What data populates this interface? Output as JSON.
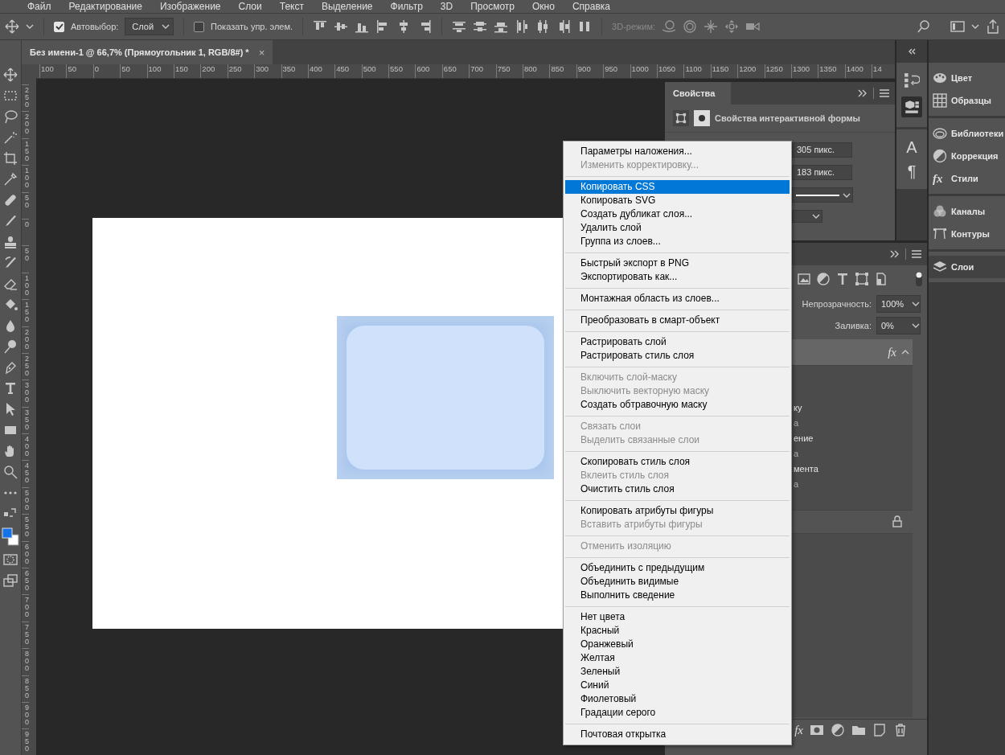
{
  "menu_bar": [
    "Файл",
    "Редактирование",
    "Изображение",
    "Слои",
    "Текст",
    "Выделение",
    "Фильтр",
    "3D",
    "Просмотр",
    "Окно",
    "Справка"
  ],
  "options_bar": {
    "auto_select": {
      "label": "Автовыбор:",
      "checked": true
    },
    "auto_select_target": "Слой",
    "show_controls": {
      "label": "Показать упр. элем.",
      "checked": false
    },
    "mode_3d_label": "3D-режим:"
  },
  "document_tab": {
    "title": "Без имени-1 @ 66,7% (Прямоугольник 1, RGB/8#) *",
    "close": "×"
  },
  "top_ruler": [
    "100",
    "50",
    "0",
    "50",
    "100",
    "150",
    "200",
    "250",
    "300",
    "350",
    "400",
    "450",
    "500",
    "550",
    "600",
    "650",
    "700",
    "750",
    "800",
    "850",
    "900",
    "950",
    "1000",
    "1050",
    "1100",
    "1150",
    "1200",
    "1250",
    "1300",
    "1350",
    "1400",
    "14"
  ],
  "left_ruler": [
    "250",
    "200",
    "150",
    "100",
    "50",
    "0",
    "50",
    "100",
    "150",
    "200",
    "250",
    "300",
    "350",
    "400",
    "450",
    "500",
    "550",
    "600",
    "650",
    "700",
    "750",
    "800",
    "850",
    "900",
    "950"
  ],
  "properties_panel": {
    "tab": "Свойства",
    "heading": "Свойства интерактивной формы",
    "width": "305 пикс.",
    "height": "183 пикс."
  },
  "layers_panel": {
    "opacity_label": "Непрозрачность:",
    "opacity": "100%",
    "fill_label": "Заливка:",
    "fill": "0%",
    "layer_row": {
      "selected": true,
      "badge": "fx"
    },
    "effects": [
      {
        "text": "ку",
        "muted": false
      },
      {
        "text": "а",
        "muted": true
      },
      {
        "text": "ение",
        "muted": false
      },
      {
        "text": "а",
        "muted": true
      },
      {
        "text": "мента",
        "muted": false
      },
      {
        "text": "а",
        "muted": true
      }
    ],
    "bottom_fx": "fx"
  },
  "panel_glyphs": {
    "character": "A",
    "paragraph": "¶"
  },
  "dock": [
    [
      {
        "label": "Цвет",
        "selected": false
      },
      {
        "label": "Образцы",
        "selected": false
      }
    ],
    [
      {
        "label": "Библиотеки",
        "selected": false
      },
      {
        "label": "Коррекция",
        "selected": false
      },
      {
        "label": "Стили",
        "selected": false,
        "glyph": "fx"
      }
    ],
    [
      {
        "label": "Каналы",
        "selected": false
      },
      {
        "label": "Контуры",
        "selected": false
      }
    ],
    [
      {
        "label": "Слои",
        "selected": true
      }
    ]
  ],
  "context_menu": {
    "groups": [
      [
        {
          "label": "Параметры наложения...",
          "disabled": false,
          "selected": false
        },
        {
          "label": "Изменить корректировку...",
          "disabled": true,
          "selected": false
        }
      ],
      [
        {
          "label": "Копировать CSS",
          "disabled": false,
          "selected": true
        },
        {
          "label": "Копировать SVG",
          "disabled": false,
          "selected": false
        },
        {
          "label": "Создать дубликат слоя...",
          "disabled": false,
          "selected": false
        },
        {
          "label": "Удалить слой",
          "disabled": false,
          "selected": false
        },
        {
          "label": "Группа из слоев...",
          "disabled": false,
          "selected": false
        }
      ],
      [
        {
          "label": "Быстрый экспорт в PNG",
          "disabled": false,
          "selected": false
        },
        {
          "label": "Экспортировать как...",
          "disabled": false,
          "selected": false
        }
      ],
      [
        {
          "label": "Монтажная область из слоев...",
          "disabled": false,
          "selected": false
        }
      ],
      [
        {
          "label": "Преобразовать в смарт-объект",
          "disabled": false,
          "selected": false
        }
      ],
      [
        {
          "label": "Растрировать слой",
          "disabled": false,
          "selected": false
        },
        {
          "label": "Растрировать стиль слоя",
          "disabled": false,
          "selected": false
        }
      ],
      [
        {
          "label": "Включить слой-маску",
          "disabled": true,
          "selected": false
        },
        {
          "label": "Выключить векторную маску",
          "disabled": true,
          "selected": false
        },
        {
          "label": "Создать обтравочную маску",
          "disabled": false,
          "selected": false
        }
      ],
      [
        {
          "label": "Связать слои",
          "disabled": true,
          "selected": false
        },
        {
          "label": "Выделить связанные слои",
          "disabled": true,
          "selected": false
        }
      ],
      [
        {
          "label": "Скопировать стиль слоя",
          "disabled": false,
          "selected": false
        },
        {
          "label": "Вклеить стиль слоя",
          "disabled": true,
          "selected": false
        },
        {
          "label": "Очистить стиль слоя",
          "disabled": false,
          "selected": false
        }
      ],
      [
        {
          "label": "Копировать атрибуты фигуры",
          "disabled": false,
          "selected": false
        },
        {
          "label": "Вставить атрибуты фигуры",
          "disabled": true,
          "selected": false
        }
      ],
      [
        {
          "label": "Отменить изоляцию",
          "disabled": true,
          "selected": false
        }
      ],
      [
        {
          "label": "Объединить с предыдущим",
          "disabled": false,
          "selected": false
        },
        {
          "label": "Объединить видимые",
          "disabled": false,
          "selected": false
        },
        {
          "label": "Выполнить сведение",
          "disabled": false,
          "selected": false
        }
      ],
      [
        {
          "label": "Нет цвета",
          "disabled": false,
          "selected": false
        },
        {
          "label": "Красный",
          "disabled": false,
          "selected": false
        },
        {
          "label": "Оранжевый",
          "disabled": false,
          "selected": false
        },
        {
          "label": "Желтая",
          "disabled": false,
          "selected": false
        },
        {
          "label": "Зеленый",
          "disabled": false,
          "selected": false
        },
        {
          "label": "Синий",
          "disabled": false,
          "selected": false
        },
        {
          "label": "Фиолетовый",
          "disabled": false,
          "selected": false
        },
        {
          "label": "Градации серого",
          "disabled": false,
          "selected": false
        }
      ],
      [
        {
          "label": "Почтовая открытка",
          "disabled": false,
          "selected": false
        }
      ]
    ]
  }
}
